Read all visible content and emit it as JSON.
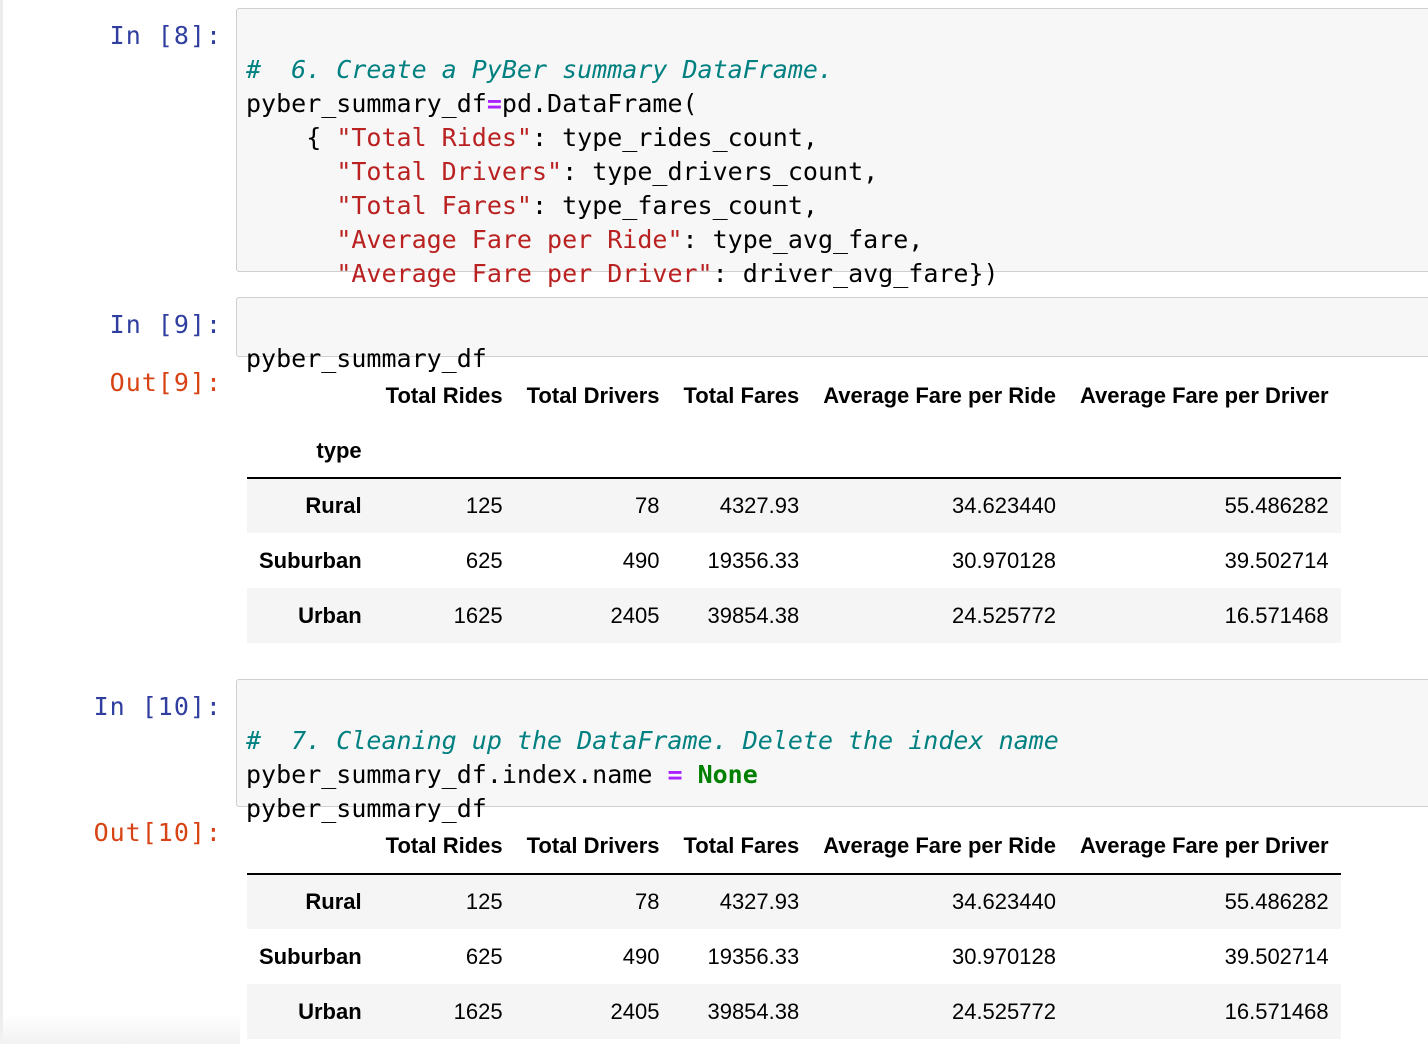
{
  "cells": {
    "c8": {
      "prompt": "In [8]:",
      "lines": {
        "l1": "#  6. Create a PyBer summary DataFrame.",
        "l2a": "pyber_summary_df",
        "l2op": "=",
        "l2b": "pd.DataFrame(",
        "l3a": "    { ",
        "l3s": "\"Total Rides\"",
        "l3b": ": type_rides_count,",
        "l4a": "      ",
        "l4s": "\"Total Drivers\"",
        "l4b": ": type_drivers_count,",
        "l5a": "      ",
        "l5s": "\"Total Fares\"",
        "l5b": ": type_fares_count,",
        "l6a": "      ",
        "l6s": "\"Average Fare per Ride\"",
        "l6b": ": type_avg_fare,",
        "l7a": "      ",
        "l7s": "\"Average Fare per Driver\"",
        "l7b": ": driver_avg_fare})"
      }
    },
    "c9": {
      "prompt": "In [9]:",
      "code": "pyber_summary_df",
      "out_prompt": "Out[9]:",
      "index_name": "type"
    },
    "c10": {
      "prompt": "In [10]:",
      "lines": {
        "l1": "#  7. Cleaning up the DataFrame. Delete the index name",
        "l2a": "pyber_summary_df.index.name ",
        "l2op": "=",
        "l2sp": " ",
        "l2kw": "None",
        "l3": "pyber_summary_df"
      },
      "out_prompt": "Out[10]:"
    }
  },
  "table": {
    "columns": [
      "Total Rides",
      "Total Drivers",
      "Total Fares",
      "Average Fare per Ride",
      "Average Fare per Driver"
    ],
    "rows": [
      {
        "index": "Rural",
        "values": [
          "125",
          "78",
          "4327.93",
          "34.623440",
          "55.486282"
        ]
      },
      {
        "index": "Suburban",
        "values": [
          "625",
          "490",
          "19356.33",
          "30.970128",
          "39.502714"
        ]
      },
      {
        "index": "Urban",
        "values": [
          "1625",
          "2405",
          "39854.38",
          "24.525772",
          "16.571468"
        ]
      }
    ]
  }
}
